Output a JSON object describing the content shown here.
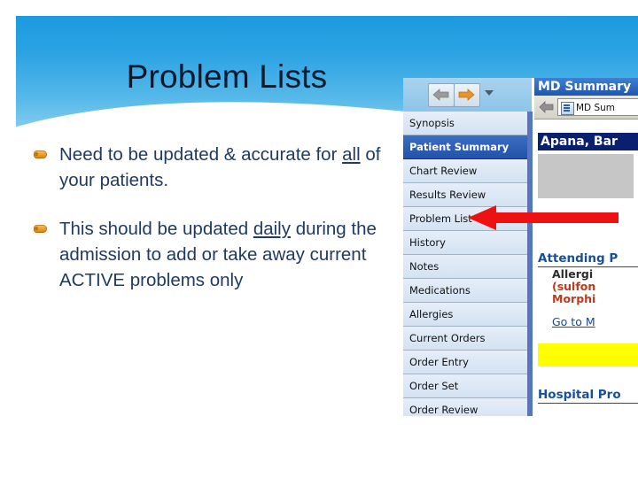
{
  "slide": {
    "title": "Problem Lists",
    "bullets": [
      {
        "pre": "Need to be updated & accurate for ",
        "emphasis": "all",
        "post": " of your patients."
      },
      {
        "pre": "This should be updated ",
        "emphasis": "daily",
        "post": " during the admission to add or take away current ACTIVE problems only"
      }
    ]
  },
  "screenshot": {
    "toolbar": {
      "back_icon": "back-arrow-icon",
      "forward_icon": "forward-arrow-icon",
      "dropdown_icon": "chevron-down-icon"
    },
    "nav_items": [
      {
        "label": "Synopsis",
        "selected": false
      },
      {
        "label": "Patient Summary",
        "selected": true
      },
      {
        "label": "Chart Review",
        "selected": false
      },
      {
        "label": "Results Review",
        "selected": false
      },
      {
        "label": "Problem List",
        "selected": false
      },
      {
        "label": "History",
        "selected": false
      },
      {
        "label": "Notes",
        "selected": false
      },
      {
        "label": "Medications",
        "selected": false
      },
      {
        "label": "Allergies",
        "selected": false
      },
      {
        "label": "Current Orders",
        "selected": false
      },
      {
        "label": "Order Entry",
        "selected": false
      },
      {
        "label": "Order Set",
        "selected": false
      },
      {
        "label": "Order Review",
        "selected": false
      }
    ],
    "pane": {
      "title": "MD Summary",
      "tab_label": "MD Sum",
      "patient_name": "Apana, Bar",
      "heading_attending": "Attending P",
      "allergy_label": "Allergi",
      "allergy_1": "(sulfon",
      "allergy_2": "Morphi",
      "goto_link": "Go to M",
      "heading_hospital": "Hospital Pro"
    }
  },
  "annotation": {
    "arrow_icon": "red-left-arrow-icon",
    "arrow_color": "#ee1111",
    "points_to": "Problem List"
  },
  "colors": {
    "banner_top": "#1c9ade",
    "banner_bottom": "#a9dcf5",
    "body_text": "#1f3a63",
    "bullet": "#ef9f2c",
    "nav_selected": "#2352a8",
    "patient_bar": "#0a1f6e",
    "allergy_red": "#c0391a",
    "highlight_yellow": "#ffff00",
    "link_blue": "#15489b"
  }
}
